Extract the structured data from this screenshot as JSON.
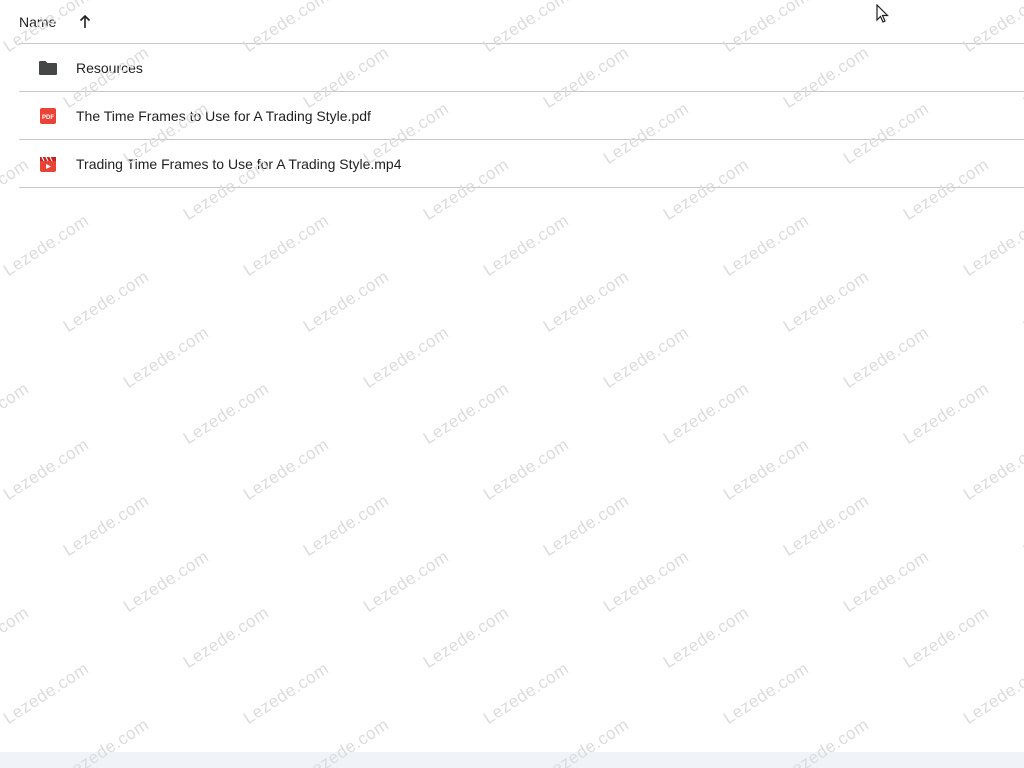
{
  "header": {
    "sort_label": "Name",
    "sort_direction": "ascending",
    "sort_icon": "arrow-up-icon"
  },
  "files": [
    {
      "name": "Resources",
      "type": "folder",
      "icon": "folder-icon",
      "icon_color": "#444746"
    },
    {
      "name": "The Time Frames to Use for A Trading Style.pdf",
      "type": "pdf",
      "icon": "pdf-icon",
      "icon_color": "#ea4335"
    },
    {
      "name": "Trading Time Frames to Use for A Trading Style.mp4",
      "type": "video",
      "icon": "video-icon",
      "icon_color": "#ea4335"
    }
  ],
  "watermark": {
    "text": "Lezede.com",
    "color": "#dcdcdc"
  },
  "colors": {
    "divider": "#c7c7c7",
    "text": "#1f1f1f",
    "bottom_bar": "#f0f4f9"
  }
}
